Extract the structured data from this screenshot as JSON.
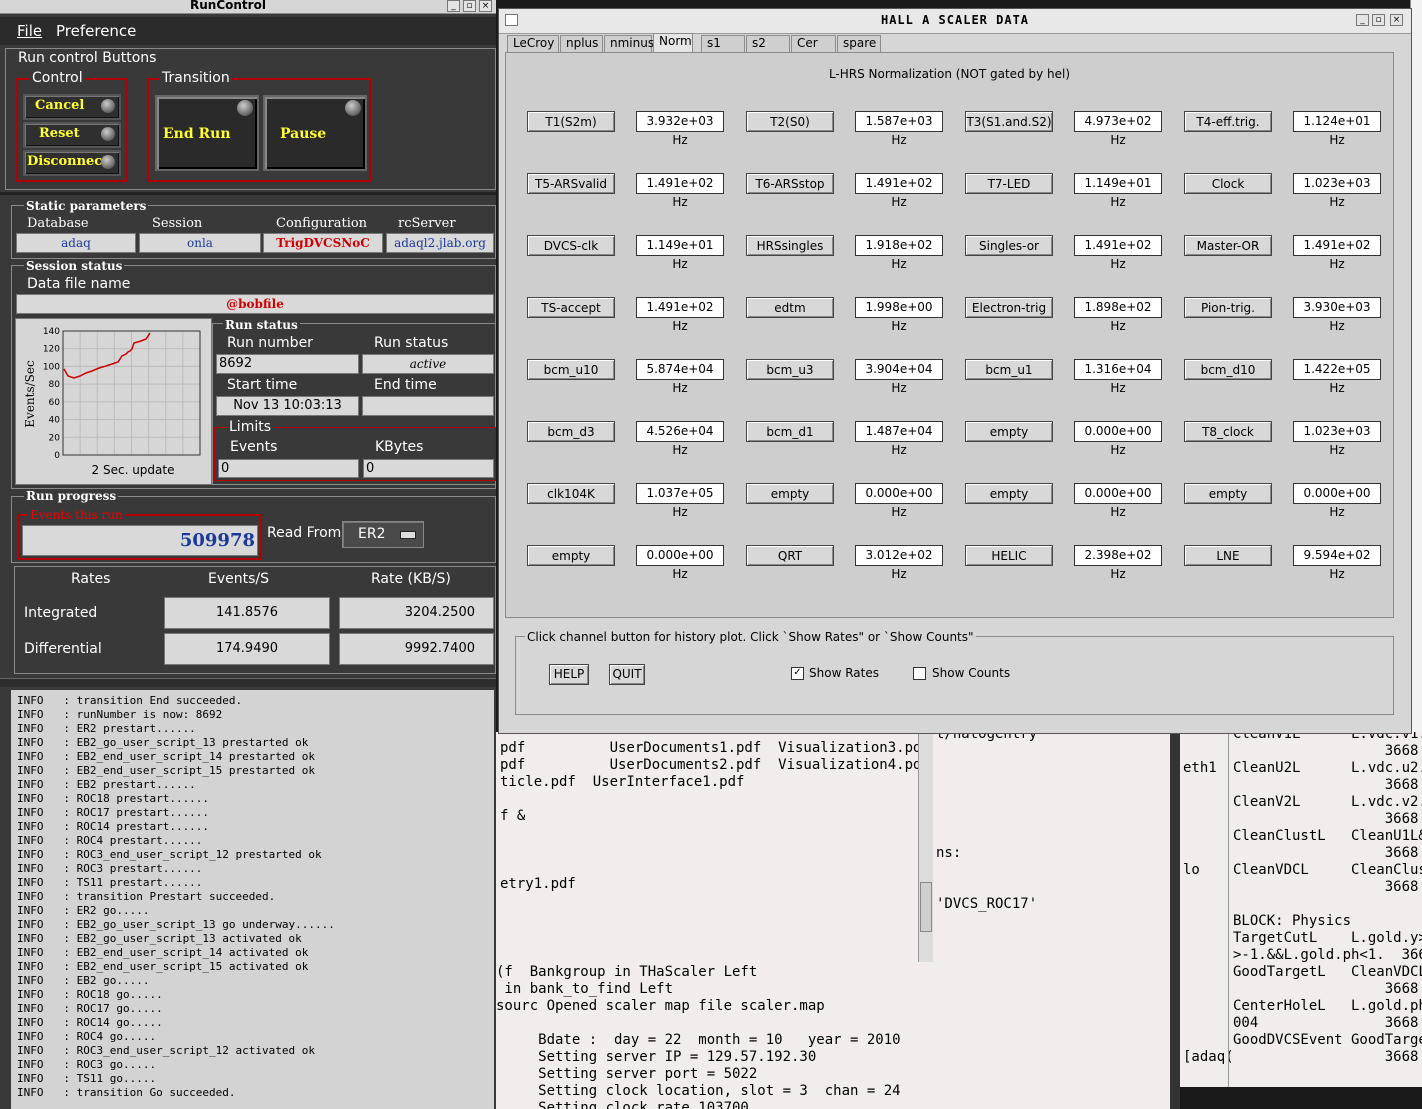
{
  "runcontrol": {
    "title": "RunControl",
    "menu": {
      "file": "File",
      "preference": "Preference"
    },
    "run_control_buttons_label": "Run control Buttons",
    "control_label": "Control",
    "transition_label": "Transition",
    "buttons": {
      "cancel": "Cancel",
      "reset": "Reset",
      "disconnect": "Disconnect",
      "end_run": "End Run",
      "pause": "Pause"
    },
    "static_params": {
      "title": "Static parameters",
      "database_label": "Database",
      "database": "adaq",
      "session_label": "Session",
      "session": "onla",
      "configuration_label": "Configuration",
      "configuration": "TrigDVCSNoC",
      "rcserver_label": "rcServer",
      "rcserver": "adaql2.jlab.org"
    },
    "session_status": {
      "title": "Session status",
      "data_file_label": "Data file name",
      "data_file": "@bobfile"
    },
    "graph": {
      "ylabel": "Events/Sec",
      "caption": "2 Sec. update",
      "yticks": [
        "140",
        "120",
        "100",
        "80",
        "60",
        "40",
        "20",
        "0"
      ]
    },
    "run_status": {
      "title": "Run status",
      "run_number_label": "Run number",
      "run_number": "8692",
      "run_status_label": "Run status",
      "run_status": "active",
      "start_time_label": "Start time",
      "start_time": "Nov 13 10:03:13",
      "end_time_label": "End time",
      "end_time": "",
      "limits_label": "Limits",
      "events_label": "Events",
      "events": "0",
      "kbytes_label": "KBytes",
      "kbytes": "0"
    },
    "run_progress": {
      "title": "Run progress",
      "events_this_run_label": "Events this run",
      "events_this_run": "509978",
      "read_from_label": "Read From:",
      "read_from": "ER2"
    },
    "rates": {
      "header": [
        "Rates",
        "Events/S",
        "Rate (KB/S)"
      ],
      "integrated_label": "Integrated",
      "integrated_events": "141.8576",
      "integrated_rate": "3204.2500",
      "differential_label": "Differential",
      "differential_events": "174.9490",
      "differential_rate": "9992.7400"
    },
    "log": [
      "INFO   : transition End succeeded.",
      "INFO   : runNumber is now: 8692",
      "INFO   : ER2 prestart......",
      "INFO   : EB2_go_user_script_13 prestarted ok",
      "INFO   : EB2_end_user_script_14 prestarted ok",
      "INFO   : EB2_end_user_script_15 prestarted ok",
      "INFO   : EB2 prestart......",
      "INFO   : ROC18 prestart......",
      "INFO   : ROC17 prestart......",
      "INFO   : ROC14 prestart......",
      "INFO   : ROC4 prestart......",
      "INFO   : ROC3_end_user_script_12 prestarted ok",
      "INFO   : ROC3 prestart......",
      "INFO   : TS11 prestart......",
      "INFO   : transition Prestart succeeded.",
      "INFO   : ER2 go.....",
      "INFO   : EB2_go_user_script_13 go underway......",
      "INFO   : EB2_go_user_script_13 activated ok",
      "INFO   : EB2_end_user_script_14 activated ok",
      "INFO   : EB2_end_user_script_15 activated ok",
      "INFO   : EB2 go.....",
      "INFO   : ROC18 go.....",
      "INFO   : ROC17 go.....",
      "INFO   : ROC14 go.....",
      "INFO   : ROC4 go.....",
      "INFO   : ROC3_end_user_script_12 activated ok",
      "INFO   : ROC3 go.....",
      "INFO   : TS11 go.....",
      "INFO   : transition Go succeeded."
    ]
  },
  "scaler": {
    "title": "HALL  A  SCALER  DATA",
    "tabs": [
      "LeCroy",
      "nplus",
      "nminus",
      "Norm",
      "s1",
      "s2",
      "Cer",
      "spare"
    ],
    "active_tab": "Norm",
    "panel_title": "L-HRS Normalization (NOT gated by hel)",
    "rows": [
      [
        [
          "T1(S2m)",
          "3.932e+03 Hz"
        ],
        [
          "T2(S0)",
          "1.587e+03 Hz"
        ],
        [
          "T3(S1.and.S2)",
          "4.973e+02 Hz"
        ],
        [
          "T4-eff.trig.",
          "1.124e+01 Hz"
        ]
      ],
      [
        [
          "T5-ARSvalid",
          "1.491e+02 Hz"
        ],
        [
          "T6-ARSstop",
          "1.491e+02 Hz"
        ],
        [
          "T7-LED",
          "1.149e+01 Hz"
        ],
        [
          "Clock",
          "1.023e+03 Hz"
        ]
      ],
      [
        [
          "DVCS-clk",
          "1.149e+01 Hz"
        ],
        [
          "HRSsingles",
          "1.918e+02 Hz"
        ],
        [
          "Singles-or",
          "1.491e+02 Hz"
        ],
        [
          "Master-OR",
          "1.491e+02 Hz"
        ]
      ],
      [
        [
          "TS-accept",
          "1.491e+02 Hz"
        ],
        [
          "edtm",
          "1.998e+00 Hz"
        ],
        [
          "Electron-trig",
          "1.898e+02 Hz"
        ],
        [
          "Pion-trig.",
          "3.930e+03 Hz"
        ]
      ],
      [
        [
          "bcm_u10",
          "5.874e+04 Hz"
        ],
        [
          "bcm_u3",
          "3.904e+04 Hz"
        ],
        [
          "bcm_u1",
          "1.316e+04 Hz"
        ],
        [
          "bcm_d10",
          "1.422e+05 Hz"
        ]
      ],
      [
        [
          "bcm_d3",
          "4.526e+04 Hz"
        ],
        [
          "bcm_d1",
          "1.487e+04 Hz"
        ],
        [
          "empty",
          "0.000e+00 Hz"
        ],
        [
          "T8_clock",
          "1.023e+03 Hz"
        ]
      ],
      [
        [
          "clk104K",
          "1.037e+05 Hz"
        ],
        [
          "empty",
          "0.000e+00 Hz"
        ],
        [
          "empty",
          "0.000e+00 Hz"
        ],
        [
          "empty",
          "0.000e+00 Hz"
        ]
      ],
      [
        [
          "empty",
          "0.000e+00 Hz"
        ],
        [
          "QRT",
          "3.012e+02 Hz"
        ],
        [
          "HELIC",
          "2.398e+02 Hz"
        ],
        [
          "LNE",
          "9.594e+02 Hz"
        ]
      ]
    ],
    "footer_hint": "Click channel button for history plot.  Click `Show Rates\" or `Show Counts\"",
    "help": "HELP",
    "quit": "QUIT",
    "show_rates": "Show Rates",
    "show_counts": "Show Counts",
    "show_rates_checked": true,
    "show_counts_checked": false
  },
  "terminal1": {
    "lines": [
      "pdf          UserDocuments1.pdf  Visualization3.pdf",
      "pdf          UserDocuments2.pdf  Visualization4.pdf",
      "ticle.pdf  UserInterface1.pdf",
      "",
      "f &",
      "",
      "",
      "",
      "etry1.pdf"
    ]
  },
  "terminal2": {
    "lines": [
      "(f  Bankgroup in THaScaler Left",
      " in bank_to_find Left",
      "sourc Opened scaler map file scaler.map",
      "",
      "     Bdate :  day = 22  month = 10   year = 2010",
      "     Setting server IP = 129.57.192.30",
      "     Setting server port = 5022",
      "     Setting clock location, slot = 3  chan = 24",
      "     Setting clock rate 103700"
    ]
  },
  "terminal3": {
    "lines": [
      "t/hatogentry",
      "",
      "",
      "",
      "",
      "",
      "",
      "ns:",
      "",
      "",
      "'DVCS_ROC17'"
    ]
  },
  "terminal4": {
    "left": [
      "eth1",
      "",
      "",
      "",
      "",
      "",
      "lo",
      "",
      "",
      "",
      "",
      "",
      "",
      "",
      "",
      "",
      "",
      "[adaq("
    ],
    "right": [
      "CleanV1L      L.vdc.v1.",
      "                  3668",
      "CleanU2L      L.vdc.u2.",
      "                  3668",
      "CleanV2L      L.vdc.v2.",
      "                  3668",
      "CleanClustL   CleanU1L&",
      "                  3668",
      "CleanVDCL     CleanClus",
      "                  3668",
      "",
      "BLOCK: Physics",
      "TargetCutL    L.gold.y>",
      ">-1.&&L.gold.ph<1.  3668",
      "GoodTargetL   CleanVDCL",
      "                  3668",
      "CenterHoleL   L.gold.ph",
      "004               3668",
      "GoodDVCSEvent GoodTarge",
      "                  3668"
    ]
  }
}
